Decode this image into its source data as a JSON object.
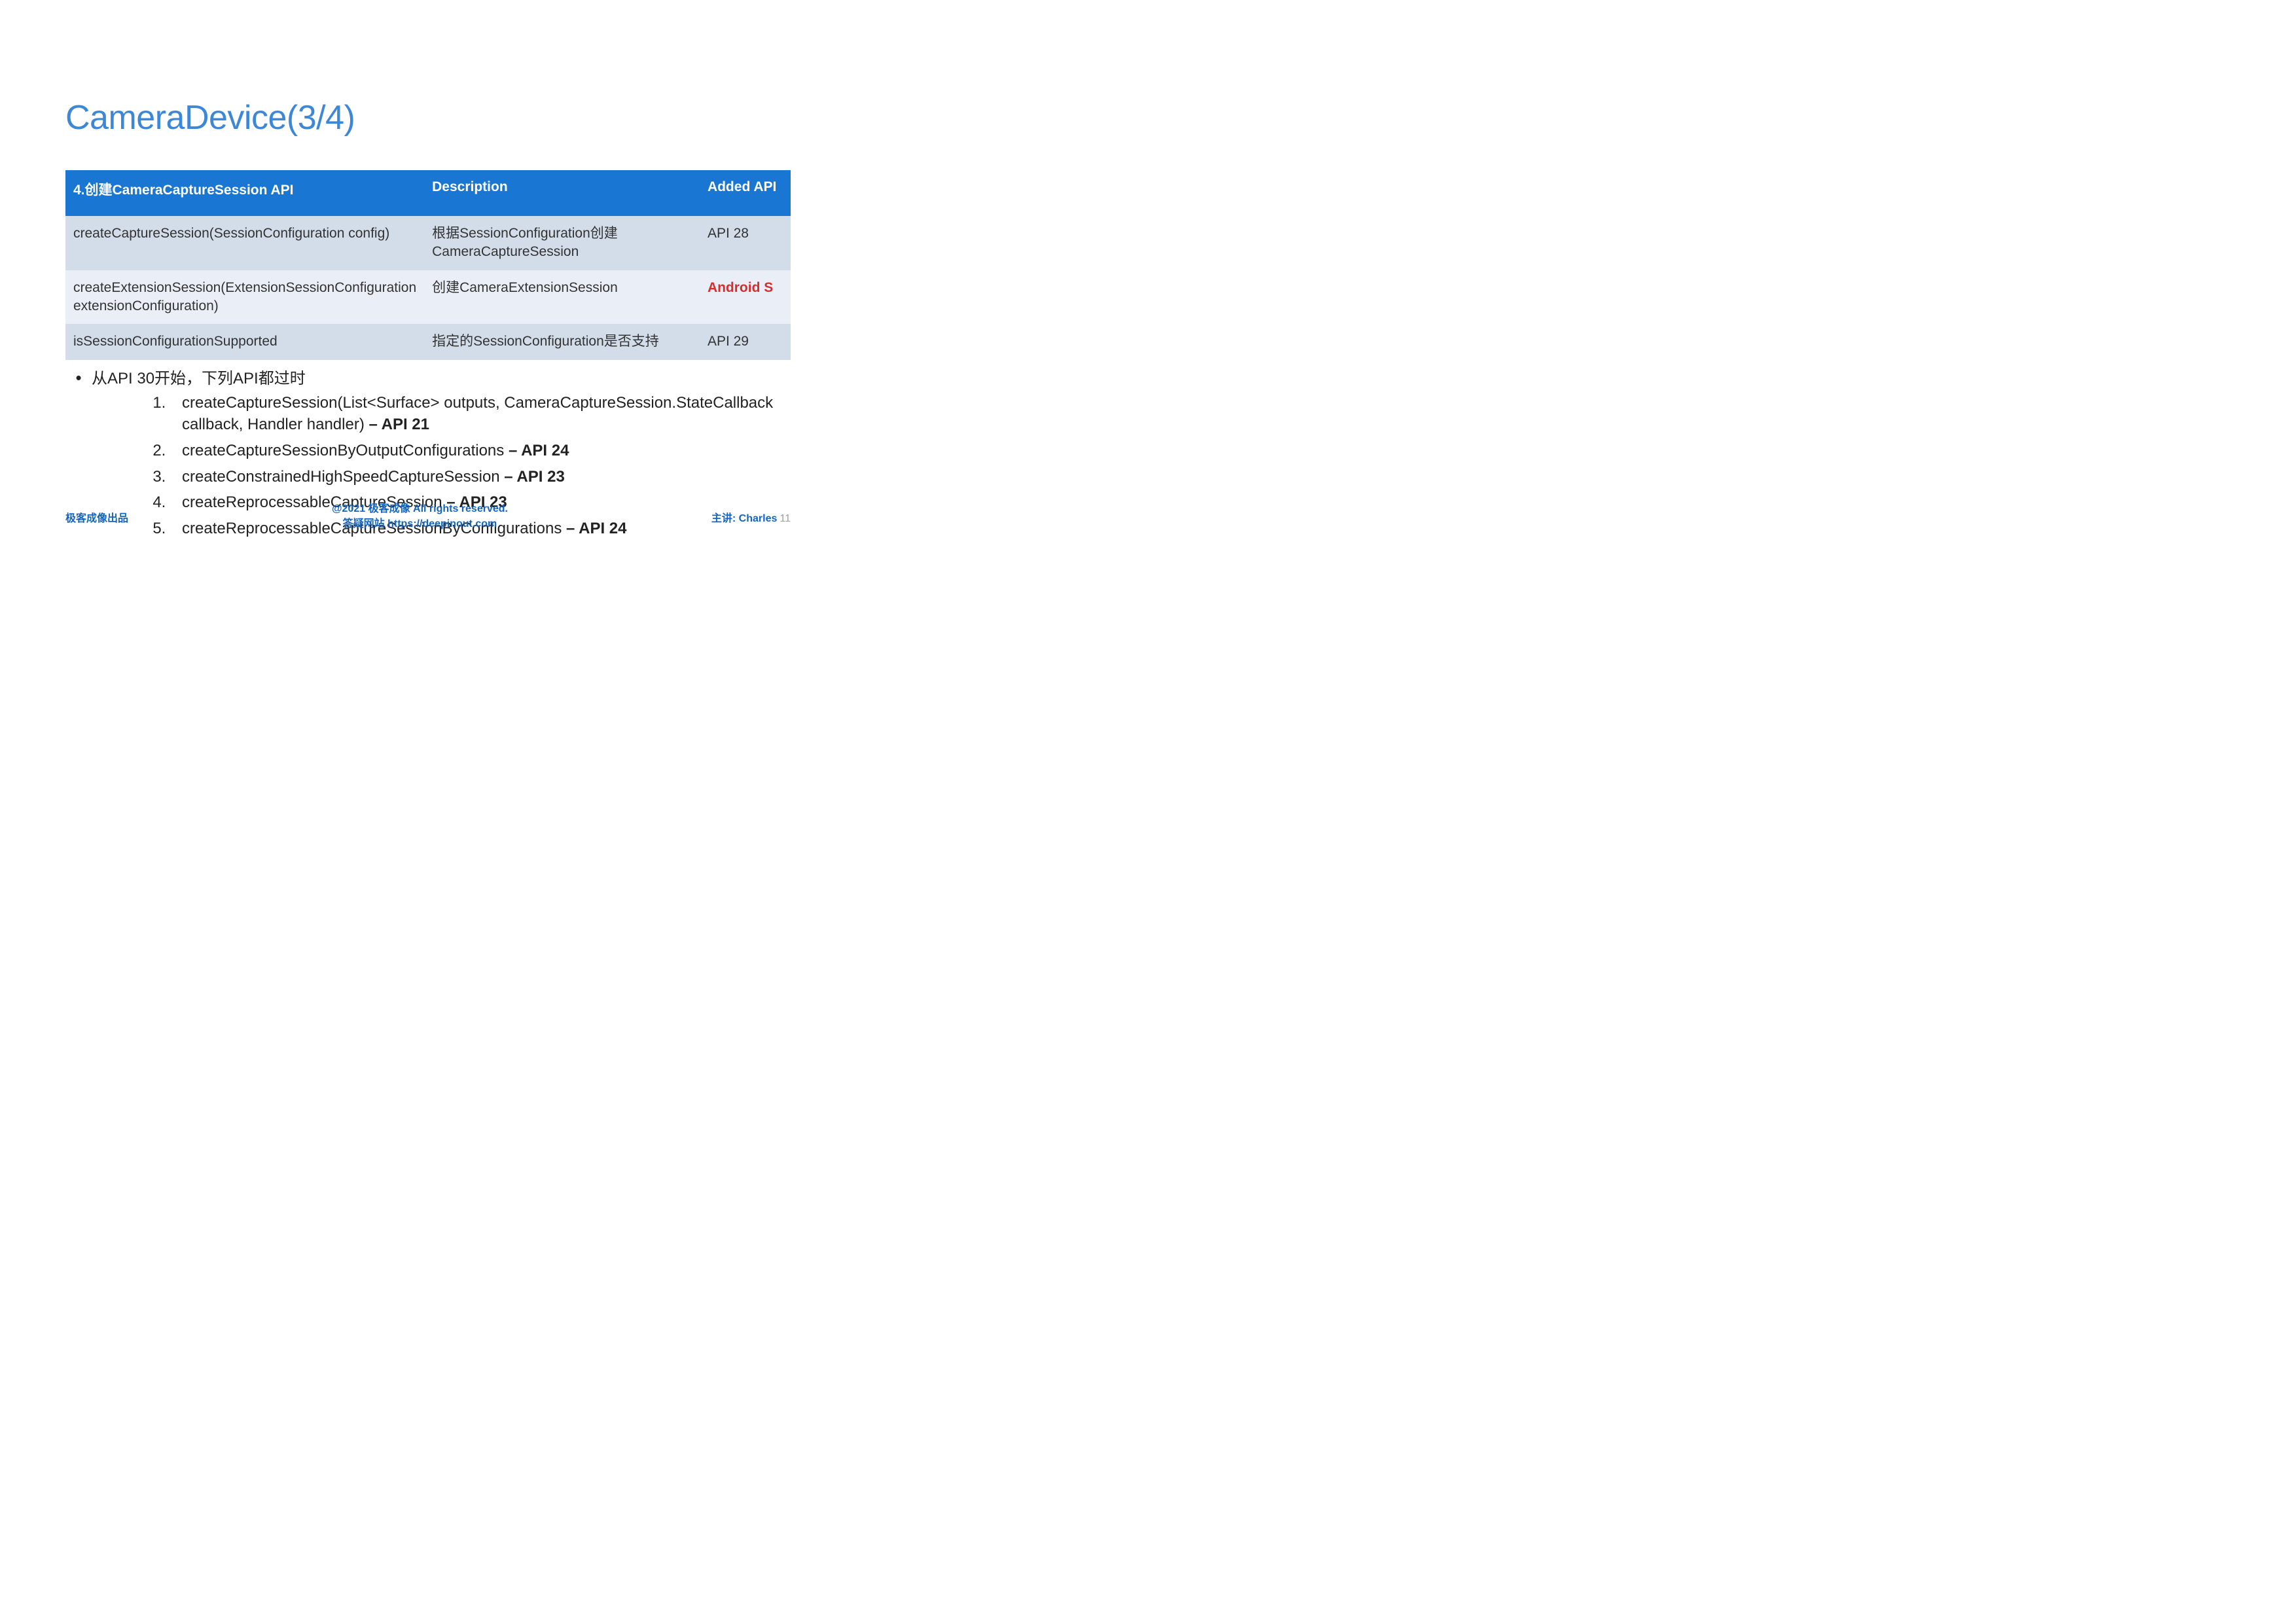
{
  "title": "CameraDevice(3/4)",
  "table": {
    "headers": [
      "4.创建CameraCaptureSession API",
      "Description",
      "Added API"
    ],
    "rows": [
      {
        "api": "createCaptureSession(SessionConfiguration config)",
        "desc": "根据SessionConfiguration创建CameraCaptureSession",
        "added": "API 28",
        "added_red": false
      },
      {
        "api": "createExtensionSession(ExtensionSessionConfiguration extensionConfiguration)",
        "desc": "创建CameraExtensionSession",
        "added": "Android S",
        "added_red": true
      },
      {
        "api": "isSessionConfigurationSupported",
        "desc": "指定的SessionConfiguration是否支持",
        "added": "API 29",
        "added_red": false
      }
    ]
  },
  "bullet_lead": "从API 30开始，下列API都过时",
  "deprecated": [
    {
      "text": "createCaptureSession(List<Surface> outputs, CameraCaptureSession.StateCallback callback, Handler handler)",
      "suffix": " – API 21"
    },
    {
      "text": "createCaptureSessionByOutputConfigurations",
      "suffix": " – API 24"
    },
    {
      "text": "createConstrainedHighSpeedCaptureSession",
      "suffix": " – API 23"
    },
    {
      "text": "createReprocessableCaptureSession",
      "suffix": " – API 23"
    },
    {
      "text": "createReprocessableCaptureSessionByConfigurations",
      "suffix": " – API 24"
    }
  ],
  "footer": {
    "left": "极客成像出品",
    "center_line1": "@2021 极客成像 All rights reserved.",
    "center_line2": "答疑网站 https://deepinout.com",
    "right_label": "主讲: Charles",
    "page": "11"
  }
}
